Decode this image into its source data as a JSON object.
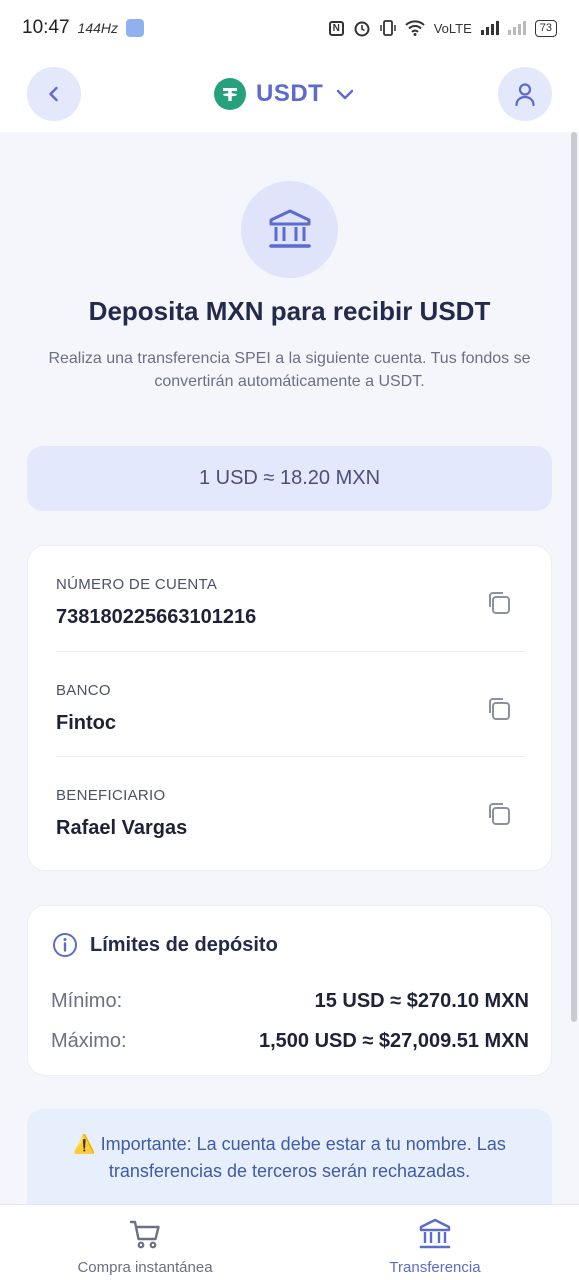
{
  "status_bar": {
    "time": "10:47",
    "refresh_rate": "144Hz",
    "network": "VoLTE",
    "battery": "73"
  },
  "header": {
    "coin": "USDT",
    "back_icon": "chevron-left-icon",
    "profile_icon": "user-icon",
    "dropdown_icon": "chevron-down-icon"
  },
  "hero": {
    "icon": "bank-icon",
    "title": "Deposita MXN para recibir USDT",
    "description": "Realiza una transferencia SPEI a la siguiente cuenta. Tus fondos se convertirán automáticamente a USDT."
  },
  "rate": {
    "text": "1 USD ≈ 18.20 MXN"
  },
  "account": {
    "rows": [
      {
        "label": "NÚMERO DE CUENTA",
        "value": "738180225663101216"
      },
      {
        "label": "BANCO",
        "value": "Fintoc"
      },
      {
        "label": "BENEFICIARIO",
        "value": "Rafael Vargas"
      }
    ]
  },
  "limits": {
    "title": "Límites de depósito",
    "minimum_label": "Mínimo:",
    "minimum_value": "15 USD ≈ $270.10 MXN",
    "maximum_label": "Máximo:",
    "maximum_value": "1,500 USD ≈ $27,009.51 MXN"
  },
  "notice": {
    "text": "⚠️ Importante: La cuenta debe estar a tu nombre. Las transferencias de terceros serán rechazadas."
  },
  "bottom_nav": {
    "items": [
      {
        "label": "Compra instantánea",
        "icon": "cart-icon",
        "active": false
      },
      {
        "label": "Transferencia",
        "icon": "bank-icon",
        "active": true
      }
    ]
  },
  "colors": {
    "accent": "#5b6bcf",
    "tether": "#26a17b",
    "background": "#f4f6fb"
  }
}
